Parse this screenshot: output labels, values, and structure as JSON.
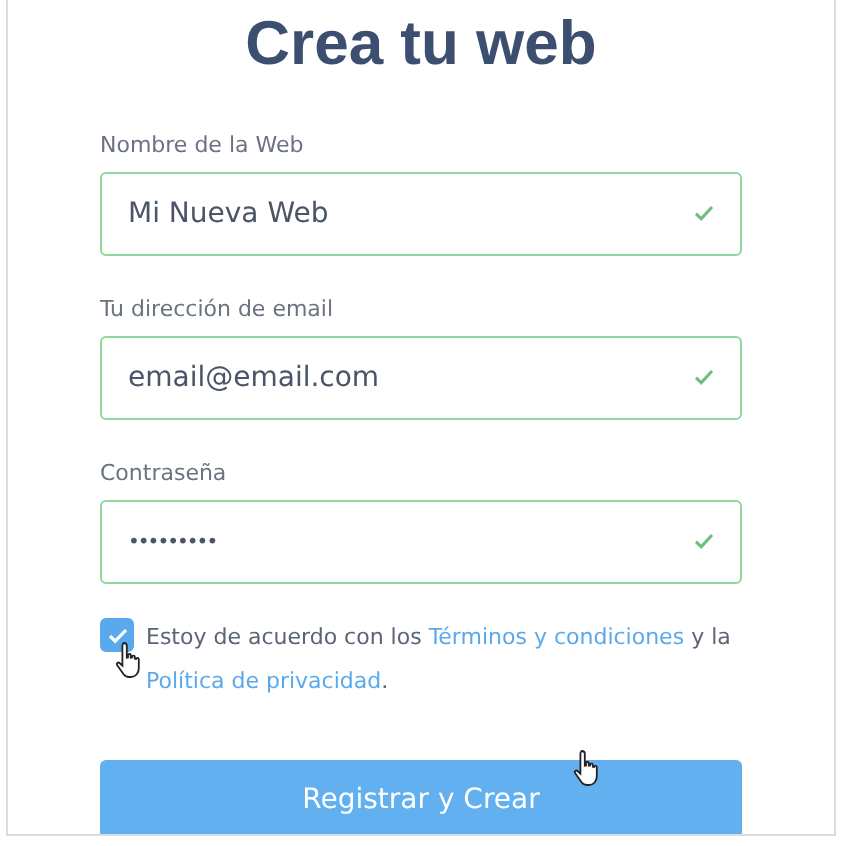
{
  "title": "Crea tu web",
  "fields": [
    {
      "label": "Nombre de la Web",
      "value": "Mi Nueva Web",
      "valid": true,
      "kind": "text"
    },
    {
      "label": "Tu dirección de email",
      "value": "email@email.com",
      "valid": true,
      "kind": "text"
    },
    {
      "label": "Contraseña",
      "value": "•••••••••",
      "valid": true,
      "kind": "password"
    }
  ],
  "agreement": {
    "checked": true,
    "text_before": "Estoy de acuerdo con los",
    "terms_link": "Términos y condiciones",
    "text_middle": "y la",
    "privacy_link": "Política de privacidad",
    "text_after": "."
  },
  "submit_button": "Registrar y Crear"
}
